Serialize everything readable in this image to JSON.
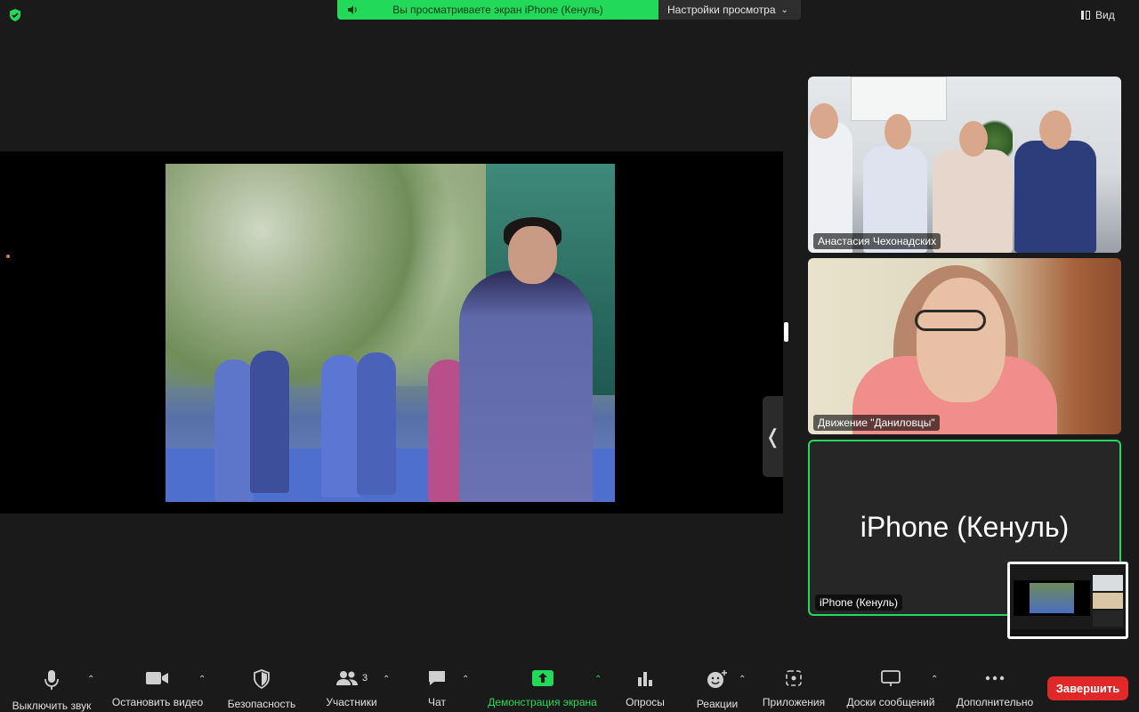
{
  "top": {
    "share_banner_text": "Вы просматриваете экран iPhone (Кенуль)",
    "view_settings_label": "Настройки просмотра",
    "view_label": "Вид"
  },
  "participants": [
    {
      "name": "Анастасия Чехонадских"
    },
    {
      "name": "Движение \"Даниловцы\""
    },
    {
      "name": "iPhone (Кенуль)",
      "big_label": "iPhone (Кенуль)"
    }
  ],
  "toolbar": {
    "mute_label": "Выключить звук",
    "video_label": "Остановить видео",
    "security_label": "Безопасность",
    "participants_label": "Участники",
    "participants_count": "3",
    "chat_label": "Чат",
    "share_label": "Демонстрация экрана",
    "polls_label": "Опросы",
    "reactions_label": "Реакции",
    "apps_label": "Приложения",
    "whiteboards_label": "Доски сообщений",
    "more_label": "Дополнительно",
    "end_label": "Завершить"
  },
  "colors": {
    "accent_green": "#23d959",
    "end_red": "#e02828",
    "toolbar_bg": "#1a1a1a"
  }
}
